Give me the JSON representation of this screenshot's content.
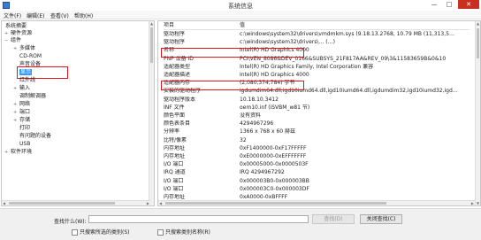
{
  "window": {
    "title": "系统信息"
  },
  "menu": [
    "文件(F)",
    "编辑(E)",
    "查看(V)",
    "帮助(H)"
  ],
  "tree": {
    "root": "系统摘要",
    "hardware_resources": "硬件资源",
    "components": "组件",
    "multimedia": "多媒体",
    "cdrom": "CD-ROM",
    "sound_device": "声音设备",
    "display": "显示",
    "infrared": "红外线",
    "input": "输入",
    "modem": "调制解调器",
    "network": "网络",
    "ports": "端口",
    "storage": "存储",
    "printing": "打印",
    "problem_devices": "有问题的设备",
    "usb": "USB",
    "software_env": "软件环境"
  },
  "detail": {
    "headers": {
      "item": "项目",
      "value": "值"
    },
    "rows": [
      {
        "item": "驱动程序",
        "value": "c:\\windows\\system32\\drivers\\vmdmkm.sys (9.18.13.2768, 10.79 MB (11,313,5…"
      },
      {
        "item": "驱动程序",
        "value": "c:\\windows\\system32\\drivers\\… (…)"
      },
      {
        "item": "名称",
        "value": "Intel(R) HD Graphics 4000"
      },
      {
        "item": "PNP 设备 ID",
        "value": "PCI\\VEN_8086&DEV_0166&SUBSYS_21F817AA&REV_09\\3&11583659B&0&10"
      },
      {
        "item": "适配器类型",
        "value": "Intel(R) HD Graphics Family, Intel Corporation 兼容"
      },
      {
        "item": "适配器描述",
        "value": "Intel(R) HD Graphics 4000"
      },
      {
        "item": "适配器内存",
        "value": "(2,080,374,784) 字节"
      },
      {
        "item": "安装的驱动程序",
        "value": "igdumdim64.dll,igd10iumd64.dll,igd10iumd64.dll,igdumdim32,igd10iumd32,igd…"
      },
      {
        "item": "驱动程序版本",
        "value": "10.18.10.3412"
      },
      {
        "item": "INF 文件",
        "value": "oem10.inf (iSVBM_w81 节)"
      },
      {
        "item": "颜色平面",
        "value": "没有资料"
      },
      {
        "item": "颜色表条目",
        "value": "4294967296"
      },
      {
        "item": "分辨率",
        "value": "1366 x 768 x 60 赫兹"
      },
      {
        "item": "比特/像素",
        "value": "32"
      },
      {
        "item": "内存地址",
        "value": "0xF1400000-0xF17FFFFF"
      },
      {
        "item": "内存地址",
        "value": "0xE0000000-0xEFFFFFFF"
      },
      {
        "item": "I/O 端口",
        "value": "0x00005000-0x0000503F"
      },
      {
        "item": "IRQ 通道",
        "value": "IRQ 4294967292"
      },
      {
        "item": "I/O 端口",
        "value": "0x000003B0-0x000003BB"
      },
      {
        "item": "I/O 端口",
        "value": "0x000003C0-0x000003DF"
      },
      {
        "item": "内存地址",
        "value": "0xA0000-0xBFFFF"
      },
      {
        "item": "驱动程序",
        "value": "c:\\windows\\system32\\drivers\\igdkmd64.sys (10.18.10.3412, 4.03 MB (4,221,44…"
      }
    ]
  },
  "find": {
    "label": "查找什么(W):",
    "value": "",
    "find_button": "查找(D)",
    "close_find_button": "关闭查找(C)",
    "checkbox_selected_category": "只搜索所选的类别(S)",
    "checkbox_category_names": "只搜索类别名称(R)"
  },
  "colors": {
    "selection": "#3399ff",
    "highlight_box": "#e0161d",
    "close_button": "#c7311f"
  }
}
